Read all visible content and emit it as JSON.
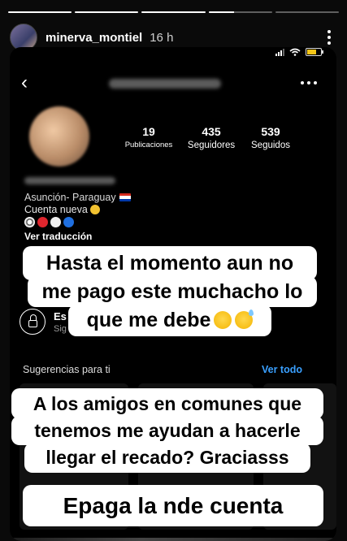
{
  "story": {
    "progress": [
      1,
      1,
      1,
      0.4,
      0
    ],
    "username": "minerva_montiel",
    "time": "16 h"
  },
  "screenshot": {
    "battery_level": 0.7,
    "profile": {
      "stats": [
        {
          "value": "19",
          "label": "Publicaciones"
        },
        {
          "value": "435",
          "label": "Seguidores"
        },
        {
          "value": "539",
          "label": "Seguidos"
        }
      ],
      "location": "Asunción- Paraguay",
      "bio": "Cuenta nueva",
      "translate": "Ver traducción"
    },
    "private_account": {
      "title": "Es",
      "subtitle": "Sig"
    },
    "suggestions": {
      "title": "Sugerencias para ti",
      "see_all": "Ver todo"
    }
  },
  "captions": {
    "line1a": "Hasta el momento aun no",
    "line1b": "me pago este muchacho lo",
    "line1c": "que me debe",
    "line2a": "A los amigos en comunes que",
    "line2b": "tenemos me ayudan a hacerle",
    "line2c": "llegar el recado? Graciasss",
    "line3": "Epaga la nde cuenta"
  },
  "colors": {
    "link": "#3aa0ff",
    "battery": "#f5c518",
    "caption_bg": "#ffffff"
  },
  "icons": [
    "chevron-left-icon",
    "more-horizontal-icon",
    "more-vertical-icon",
    "lock-icon",
    "paraguay-flag-icon",
    "sad-face-emoji",
    "grin-emoji",
    "sweat-smile-emoji"
  ]
}
